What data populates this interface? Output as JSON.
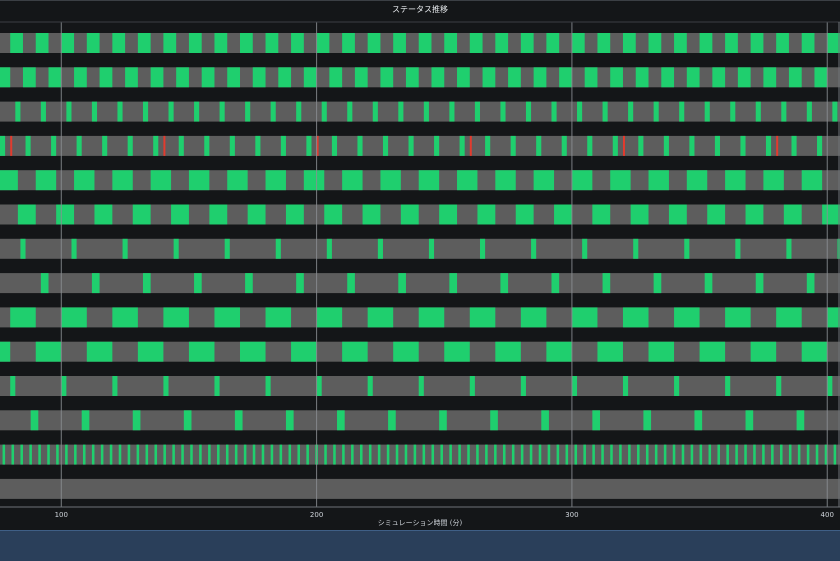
{
  "chart_data": {
    "type": "timeline",
    "title": "ステータス推移",
    "xlabel": "シミュレーション時間 (分)",
    "xlim": [
      76,
      405
    ],
    "xticks": [
      100,
      200,
      300,
      400
    ],
    "grid": true,
    "rows": [
      {
        "period": 10,
        "phase": 0,
        "active": 5,
        "fault_at": []
      },
      {
        "period": 10,
        "phase": 5,
        "active": 5,
        "fault_at": []
      },
      {
        "period": 10,
        "phase": 2,
        "active": 2,
        "fault_at": []
      },
      {
        "period": 10,
        "phase": 6,
        "active": 2,
        "fault_at": [
          80,
          140,
          200,
          260,
          320,
          380
        ]
      },
      {
        "period": 15,
        "phase": 0,
        "active": 8,
        "fault_at": []
      },
      {
        "period": 15,
        "phase": 8,
        "active": 7,
        "fault_at": []
      },
      {
        "period": 20,
        "phase": 4,
        "active": 2,
        "fault_at": []
      },
      {
        "period": 20,
        "phase": 12,
        "active": 3,
        "fault_at": []
      },
      {
        "period": 20,
        "phase": 0,
        "active": 10,
        "fault_at": []
      },
      {
        "period": 20,
        "phase": 10,
        "active": 10,
        "fault_at": []
      },
      {
        "period": 20,
        "phase": 0,
        "active": 2,
        "fault_at": []
      },
      {
        "period": 20,
        "phase": 8,
        "active": 3,
        "fault_at": []
      },
      {
        "period": 3.5,
        "phase": 0,
        "active": 1,
        "fault_at": []
      },
      {
        "period": 0,
        "phase": 0,
        "active": 0,
        "fault_at": []
      }
    ],
    "colors": {
      "active": "#1fcf6e",
      "idle": "#5d5d5d",
      "fault": "#e23b2e",
      "background": "#141618",
      "grid": "#8b8f94"
    }
  }
}
